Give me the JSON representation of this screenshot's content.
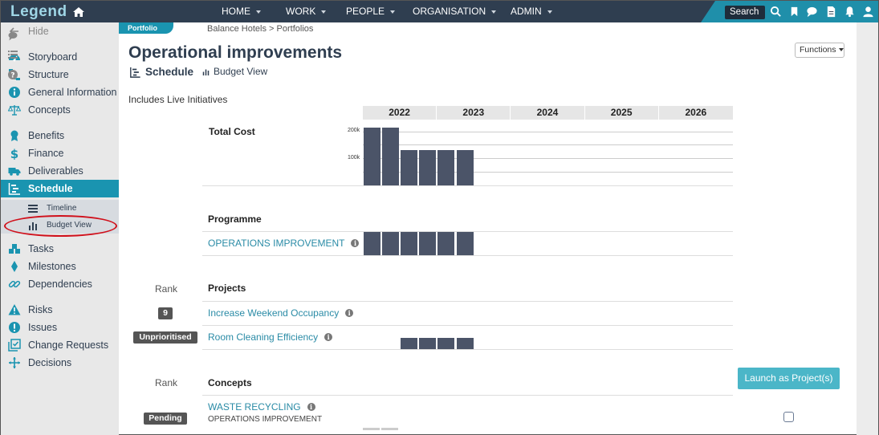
{
  "app": {
    "logo": "Legend",
    "nav": [
      "HOME",
      "WORK",
      "PEOPLE",
      "ORGANISATION",
      "ADMIN"
    ],
    "search_label": "Search"
  },
  "sidebar": {
    "hide_label": "Hide",
    "items": [
      "Storyboard",
      "Structure",
      "General Information",
      "Concepts",
      "Benefits",
      "Finance",
      "Deliverables",
      "Schedule",
      "Tasks",
      "Milestones",
      "Dependencies",
      "Risks",
      "Issues",
      "Change Requests",
      "Decisions"
    ],
    "sub_items": [
      "Timeline",
      "Budget View"
    ],
    "active": "Schedule",
    "annotated": "Budget View"
  },
  "content": {
    "portfolio_tab": "Portfolio",
    "breadcrumb": "Balance Hotels > Portfolios",
    "title": "Operational improvements",
    "functions_label": "Functions",
    "view_tabs": [
      "Schedule",
      "Budget View"
    ],
    "includes_text": "Includes Live Initiatives",
    "years": [
      "2022",
      "2023",
      "2024",
      "2025",
      "2026"
    ],
    "total_cost_label": "Total Cost",
    "axis_labels": [
      "200k",
      "100k"
    ],
    "programme_label": "Programme",
    "programme_row": "OPERATIONS IMPROVEMENT",
    "rank_label": "Rank",
    "projects_label": "Projects",
    "projects": [
      {
        "name": "Increase Weekend Occupancy",
        "badge": "9"
      },
      {
        "name": "Room Cleaning Efficiency",
        "badge": "Unprioritised"
      }
    ],
    "concepts_label": "Concepts",
    "concepts": [
      {
        "name": "WASTE RECYCLING",
        "sub": "OPERATIONS IMPROVEMENT",
        "badge": "Pending"
      }
    ],
    "launch_label": "Launch as Project(s)"
  },
  "colors": {
    "topbar": "#2f3e50",
    "accent": "#1a94b0",
    "bar": "#4b5468",
    "link": "#2a8ba6",
    "button": "#4bb6c8",
    "annotation": "#d0101b"
  },
  "chart_data": {
    "type": "bar",
    "title": "Total Cost",
    "x_periods": [
      "2022",
      "2023",
      "2024",
      "2025",
      "2026"
    ],
    "bars_per_period": 5,
    "total_cost_values_k": [
      215,
      215,
      130,
      130,
      130,
      130
    ],
    "ylim_k": [
      0,
      220
    ],
    "ticks_k": [
      200,
      100
    ],
    "programme_bars": 6,
    "project_bars_room_cleaning": 4
  }
}
